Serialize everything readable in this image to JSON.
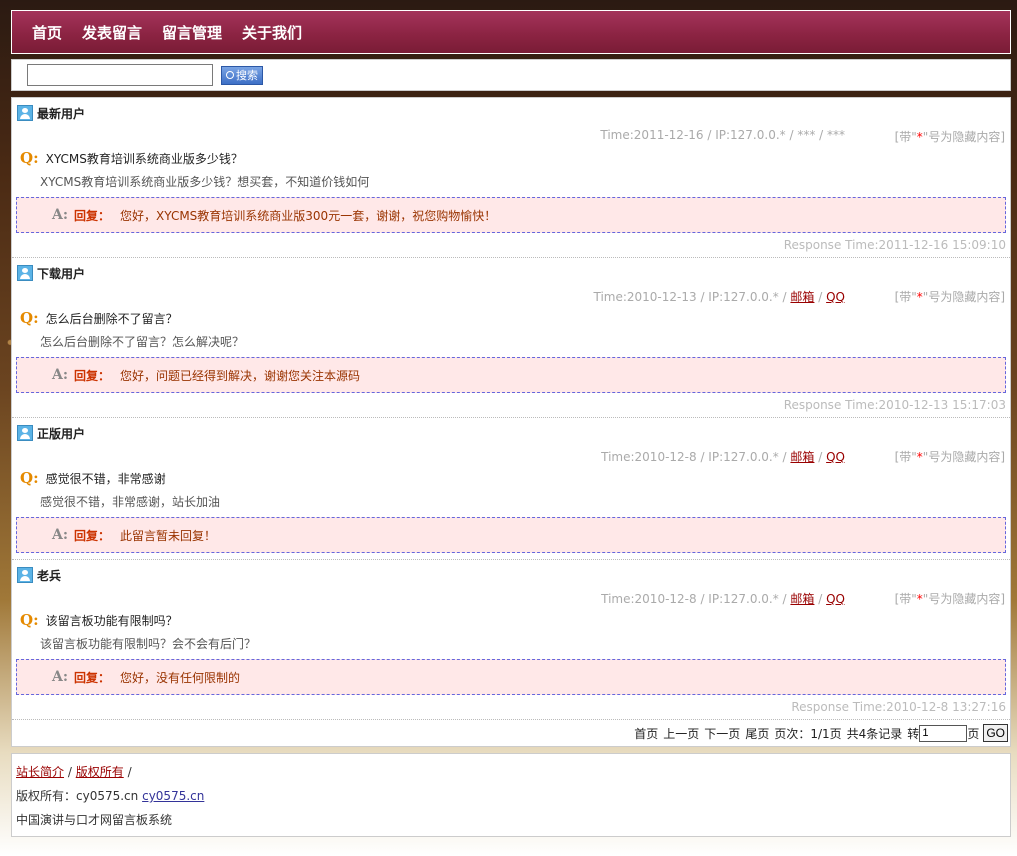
{
  "nav": [
    "首页",
    "发表留言",
    "留言管理",
    "关于我们"
  ],
  "search": {
    "placeholder": "",
    "button_label": "搜索"
  },
  "labels": {
    "reply_label": "回复：",
    "hidden_hint_prefix": "[带\"",
    "hidden_hint_star": "*",
    "hidden_hint_suffix": "\"号为隐藏内容]",
    "q_mark": "Q:",
    "a_mark": "A:"
  },
  "messages": [
    {
      "user": "最新用户",
      "time": "Time:2011-12-16 / IP:127.0.0.* / *** / ***",
      "email": "",
      "qq": "",
      "title": "XYCMS教育培训系统商业版多少钱？",
      "body": "XYCMS教育培训系统商业版多少钱？想买套，不知道价钱如何",
      "reply": "您好，XYCMS教育培训系统商业版300元一套，谢谢，祝您购物愉快！",
      "response": "Response Time:2011-12-16 15:09:10"
    },
    {
      "user": "下载用户",
      "time": "Time:2010-12-13 / IP:127.0.0.* / ",
      "email": "邮箱",
      "qq": "QQ",
      "title": "怎么后台删除不了留言？",
      "body": "怎么后台删除不了留言？怎么解决呢？",
      "reply": "您好，问题已经得到解决，谢谢您关注本源码",
      "response": "Response Time:2010-12-13 15:17:03"
    },
    {
      "user": "正版用户",
      "time": "Time:2010-12-8 / IP:127.0.0.* / ",
      "email": "邮箱",
      "qq": "QQ",
      "title": "感觉很不错，非常感谢",
      "body": "感觉很不错，非常感谢，站长加油",
      "reply": "此留言暂未回复！",
      "response": ""
    },
    {
      "user": "老兵",
      "time": "Time:2010-12-8 / IP:127.0.0.* / ",
      "email": "邮箱",
      "qq": "QQ",
      "title": "该留言板功能有限制吗？",
      "body": "该留言板功能有限制吗？会不会有后门？",
      "reply": "您好，没有任何限制的",
      "response": "Response Time:2010-12-8 13:27:16"
    }
  ],
  "pager": {
    "first": "首页",
    "prev": "上一页",
    "next": "下一页",
    "last": "尾页",
    "page_info": "页次：1/1页",
    "total": "共4条记录",
    "goto_label": "转",
    "page_value": "1",
    "page_suffix": "页",
    "go_label": "GO"
  },
  "footer": {
    "links": [
      "站长简介",
      "版权所有"
    ],
    "sep": "/",
    "copyright_prefix": "版权所有：cy0575.cn",
    "site_link": "cy0575.cn",
    "system_name": "中国演讲与口才网留言板系统"
  }
}
